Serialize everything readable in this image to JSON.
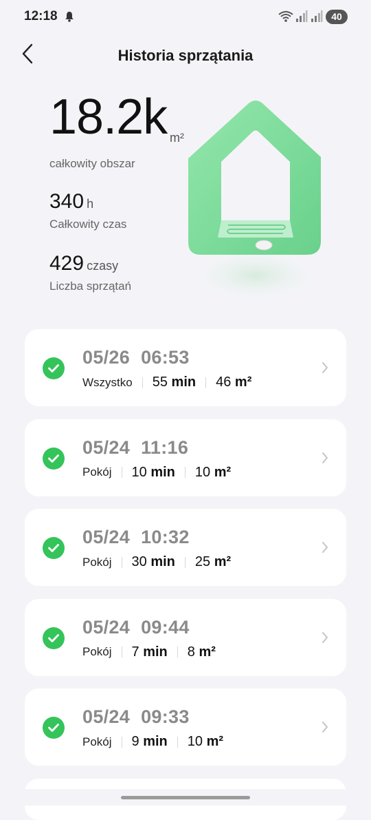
{
  "status_bar": {
    "time": "12:18",
    "battery": "40"
  },
  "header": {
    "title": "Historia sprzątania"
  },
  "summary": {
    "area_value": "18.2k",
    "area_unit": "m²",
    "area_label": "całkowity obszar",
    "time_value": "340",
    "time_unit": "h",
    "time_label": "Całkowity czas",
    "count_value": "429",
    "count_unit": "czasy",
    "count_label": "Liczba sprzątań"
  },
  "sessions": [
    {
      "date": "05/26",
      "time": "06:53",
      "mode": "Wszystko",
      "duration_num": "55",
      "duration_unit": "min",
      "area_num": "46",
      "area_unit": "m²"
    },
    {
      "date": "05/24",
      "time": "11:16",
      "mode": "Pokój",
      "duration_num": "10",
      "duration_unit": "min",
      "area_num": "10",
      "area_unit": "m²"
    },
    {
      "date": "05/24",
      "time": "10:32",
      "mode": "Pokój",
      "duration_num": "30",
      "duration_unit": "min",
      "area_num": "25",
      "area_unit": "m²"
    },
    {
      "date": "05/24",
      "time": "09:44",
      "mode": "Pokój",
      "duration_num": "7",
      "duration_unit": "min",
      "area_num": "8",
      "area_unit": "m²"
    },
    {
      "date": "05/24",
      "time": "09:33",
      "mode": "Pokój",
      "duration_num": "9",
      "duration_unit": "min",
      "area_num": "10",
      "area_unit": "m²"
    }
  ],
  "colors": {
    "accent_green": "#34c45a",
    "background": "#f4f4f8",
    "card": "#ffffff"
  },
  "icons": {
    "back": "chevron-left-icon",
    "row_status": "check-circle-icon",
    "row_open": "chevron-right-icon",
    "notification": "bell-icon"
  }
}
